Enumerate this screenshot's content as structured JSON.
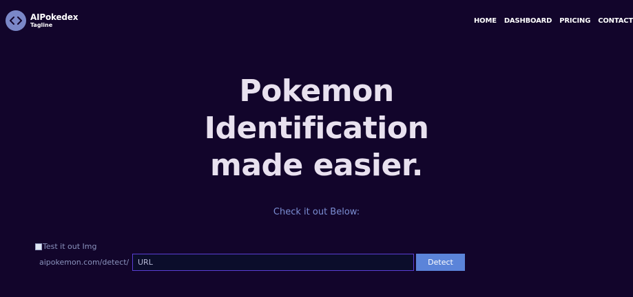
{
  "brand": {
    "name": "AIPokedex",
    "tagline": "Tagline",
    "icon": "code-brackets-icon"
  },
  "nav": {
    "items": [
      {
        "label": "HOME"
      },
      {
        "label": "DASHBOARD"
      },
      {
        "label": "PRICING"
      },
      {
        "label": "CONTACT"
      }
    ]
  },
  "hero": {
    "lines": [
      "Pokemon",
      "Identification",
      "made easier."
    ]
  },
  "subtitle": "Check it out Below:",
  "test_image": {
    "alt_text": "Test it out Img",
    "icon": "broken-image-icon"
  },
  "detect_form": {
    "prefix": "aipokemon.com/detect/",
    "input_placeholder": "URL",
    "input_value": "",
    "button_label": "Detect"
  },
  "colors": {
    "background": "#12052b",
    "hero_text": "#e8e1ef",
    "subtitle_text": "#7b8ed3",
    "button_bg": "#5b84d9",
    "input_border": "#5a3fd6",
    "logo_circle": "#7a87c7"
  }
}
